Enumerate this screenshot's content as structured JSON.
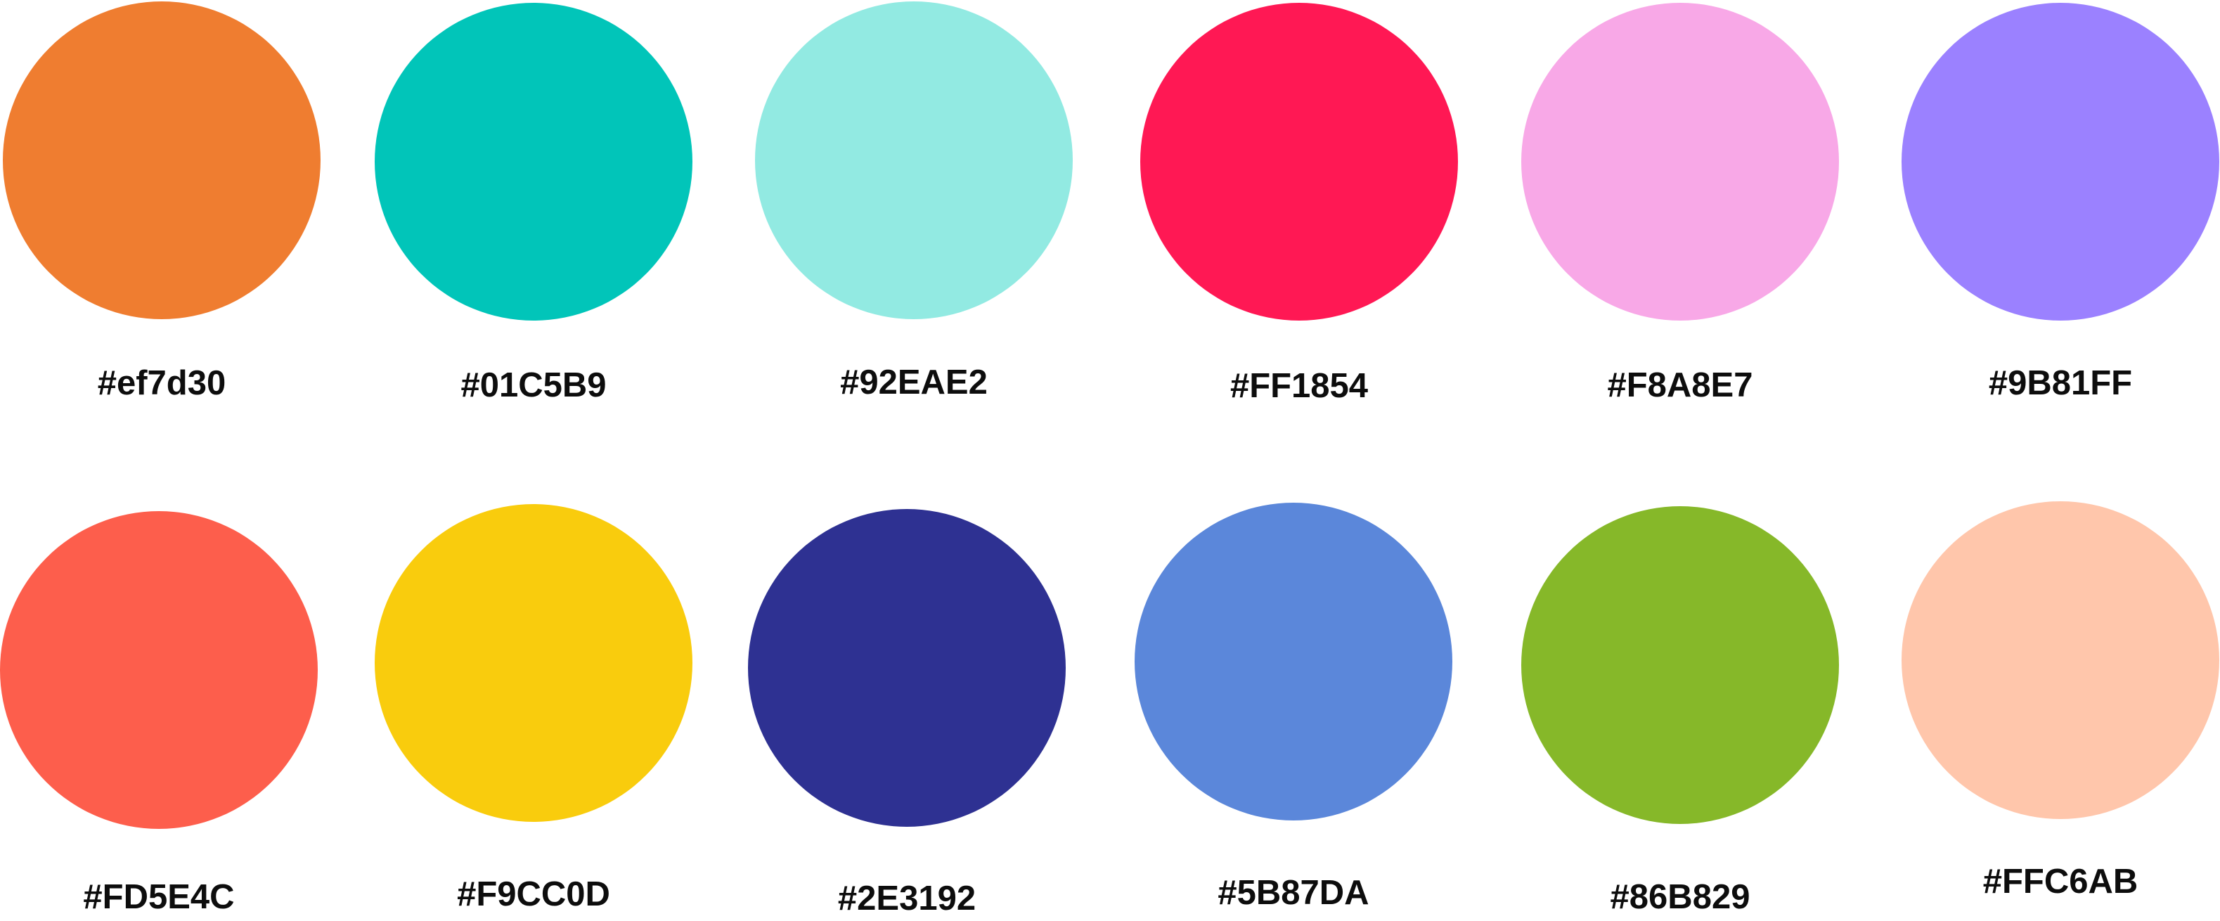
{
  "palette": {
    "rows": [
      {
        "swatches": [
          {
            "label": "#ef7d30",
            "color": "#ef7d30"
          },
          {
            "label": "#01C5B9",
            "color": "#01C5B9"
          },
          {
            "label": "#92EAE2",
            "color": "#92EAE2"
          },
          {
            "label": "#FF1854",
            "color": "#FF1854"
          },
          {
            "label": "#F8A8E7",
            "color": "#F8A8E7"
          },
          {
            "label": "#9B81FF",
            "color": "#9B81FF"
          }
        ]
      },
      {
        "swatches": [
          {
            "label": "#FD5E4C",
            "color": "#FD5E4C"
          },
          {
            "label": "#F9CC0D",
            "color": "#F9CC0D"
          },
          {
            "label": "#2E3192",
            "color": "#2E3192"
          },
          {
            "label": "#5B87DA",
            "color": "#5B87DA"
          },
          {
            "label": "#86B829",
            "color": "#86B829"
          },
          {
            "label": "#FFC6AB",
            "color": "#FFC6AB"
          }
        ]
      }
    ]
  }
}
